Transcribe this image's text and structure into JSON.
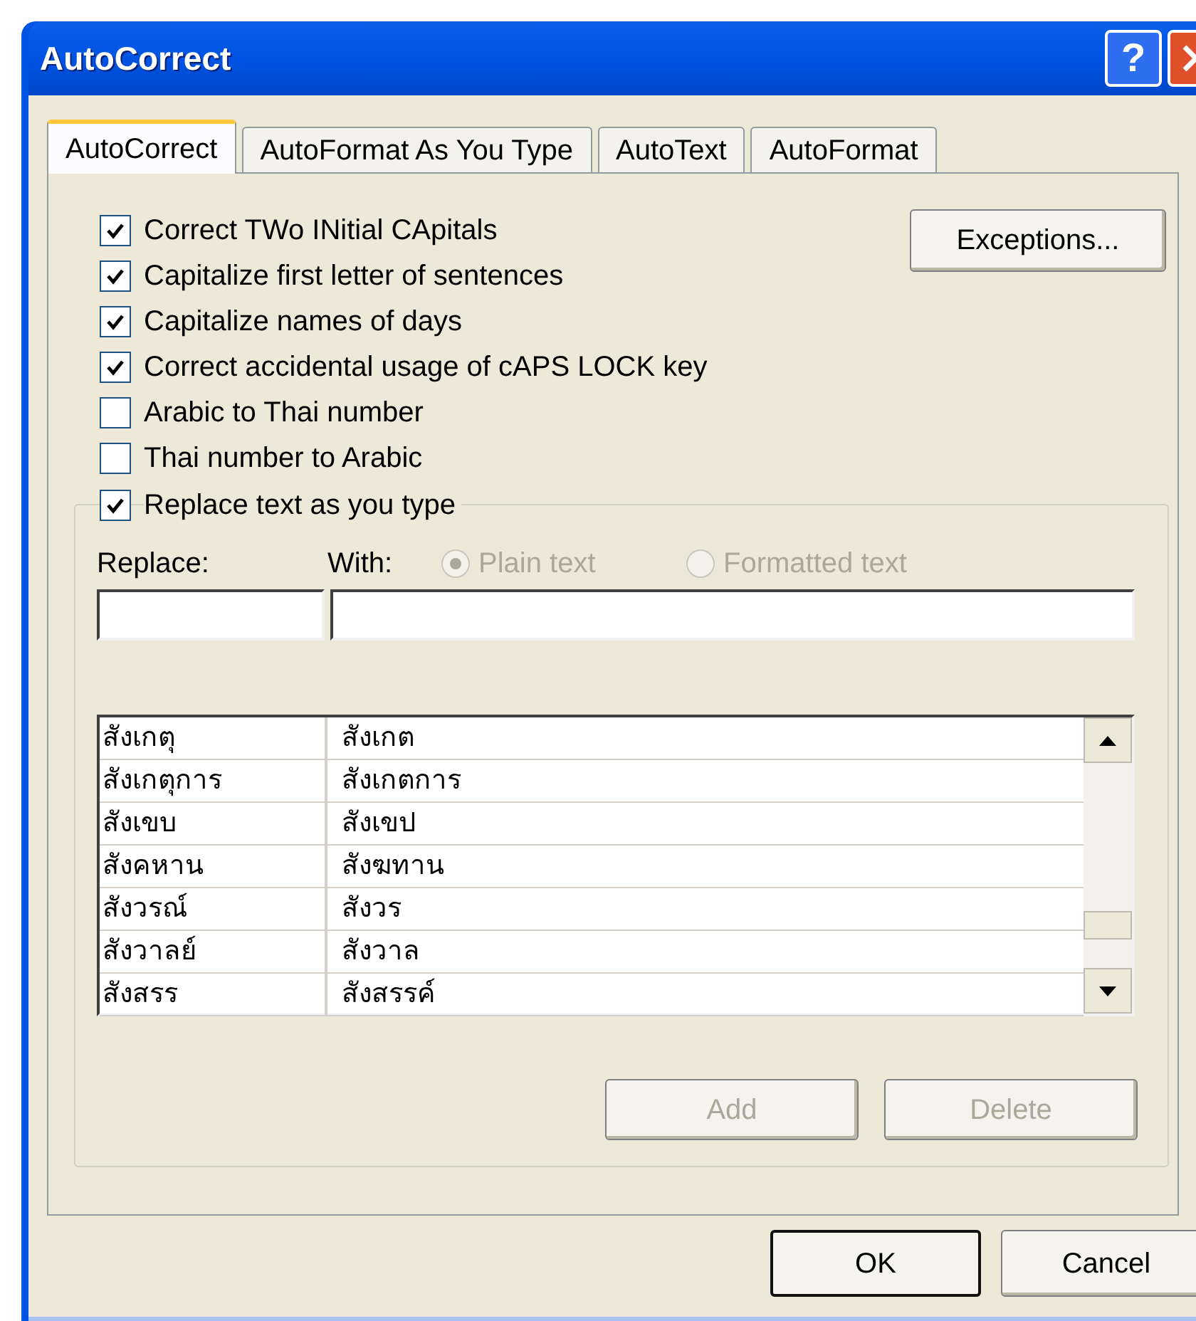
{
  "window": {
    "title": "AutoCorrect",
    "help_button": "?"
  },
  "tabs": [
    {
      "label": "AutoCorrect",
      "selected": true
    },
    {
      "label": "AutoFormat As You Type",
      "selected": false
    },
    {
      "label": "AutoText",
      "selected": false
    },
    {
      "label": "AutoFormat",
      "selected": false
    }
  ],
  "exceptions_button": "Exceptions...",
  "options": [
    {
      "label": "Correct TWo INitial CApitals",
      "checked": true
    },
    {
      "label": "Capitalize first letter of sentences",
      "checked": true
    },
    {
      "label": "Capitalize names of days",
      "checked": true
    },
    {
      "label": "Correct accidental usage of cAPS LOCK key",
      "checked": true
    },
    {
      "label": "Arabic to Thai number",
      "checked": false
    },
    {
      "label": "Thai number to Arabic",
      "checked": false
    }
  ],
  "replace_group": {
    "label": "Replace text as you type",
    "checked": true,
    "replace_label": "Replace:",
    "with_label": "With:",
    "format_options": [
      {
        "label": "Plain text",
        "selected": true,
        "disabled": true
      },
      {
        "label": "Formatted text",
        "selected": false,
        "disabled": true
      }
    ],
    "rows": [
      {
        "replace": "สังเกตุ",
        "with": "สังเกต"
      },
      {
        "replace": "สังเกตุการ",
        "with": "สังเกตการ"
      },
      {
        "replace": "สังเขบ",
        "with": "สังเขป"
      },
      {
        "replace": "สังคหาน",
        "with": "สังฆทาน"
      },
      {
        "replace": "สังวรณ์",
        "with": "สังวร"
      },
      {
        "replace": "สังวาลย์",
        "with": "สังวาล"
      },
      {
        "replace": "สังสรร",
        "with": "สังสรรค์"
      }
    ],
    "buttons": [
      {
        "label": "Add",
        "disabled": true
      },
      {
        "label": "Delete",
        "disabled": true
      }
    ]
  },
  "footer_buttons": [
    {
      "label": "OK",
      "default": true
    },
    {
      "label": "Cancel",
      "default": false
    }
  ]
}
